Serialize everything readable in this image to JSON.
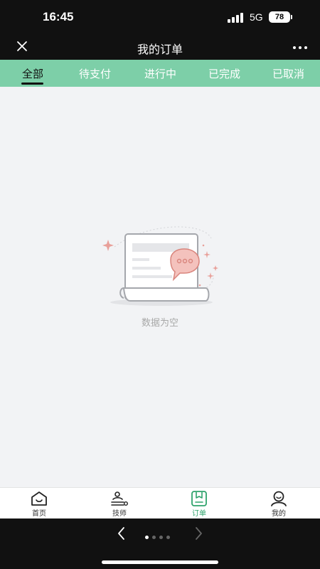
{
  "status_bar": {
    "time": "16:45",
    "network": "5G",
    "battery": "78",
    "icons": [
      "signal-icon",
      "battery-icon"
    ]
  },
  "header": {
    "title": "我的订单",
    "close_icon": "close-icon",
    "more_icon": "more-icon"
  },
  "tabs": [
    {
      "label": "全部",
      "active": true
    },
    {
      "label": "待支付",
      "active": false
    },
    {
      "label": "进行中",
      "active": false
    },
    {
      "label": "已完成",
      "active": false
    },
    {
      "label": "已取消",
      "active": false
    }
  ],
  "empty_state": {
    "text": "数据为空",
    "icon": "empty-document-chat-icon"
  },
  "bottom_nav": [
    {
      "label": "首页",
      "icon": "home-icon",
      "active": false
    },
    {
      "label": "技师",
      "icon": "technician-icon",
      "active": false
    },
    {
      "label": "订单",
      "icon": "order-icon",
      "active": true
    },
    {
      "label": "我的",
      "icon": "profile-icon",
      "active": false
    }
  ],
  "browser_bar": {
    "icons": [
      "back-icon",
      "forward-icon"
    ],
    "page_count": 4,
    "current_page": 1
  },
  "colors": {
    "tab_bar": "#7dcfa8",
    "active_nav": "#2fa36c",
    "background": "#f2f3f5",
    "header": "#111111",
    "illustration_accent": "#e8a09a"
  }
}
